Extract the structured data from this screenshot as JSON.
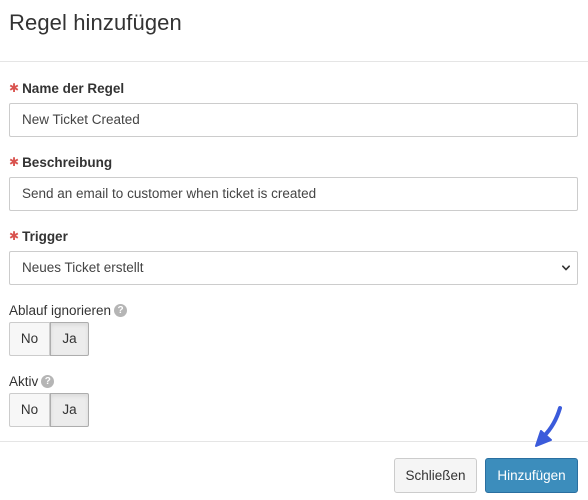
{
  "modal": {
    "title": "Regel hinzufügen"
  },
  "form": {
    "name": {
      "label": "Name der Regel",
      "required_mark": "✱",
      "value": "New Ticket Created"
    },
    "description": {
      "label": "Beschreibung",
      "required_mark": "✱",
      "value": "Send an email to customer when ticket is created"
    },
    "trigger": {
      "label": "Trigger",
      "required_mark": "✱",
      "selected": "Neues Ticket erstellt"
    },
    "ignore_flow": {
      "label": "Ablauf ignorieren",
      "help": "?",
      "no_label": "No",
      "yes_label": "Ja",
      "selected": "Ja"
    },
    "active": {
      "label": "Aktiv",
      "help": "?",
      "no_label": "No",
      "yes_label": "Ja",
      "selected": "Ja"
    }
  },
  "footer": {
    "close_label": "Schließen",
    "add_label": "Hinzufügen"
  },
  "colors": {
    "primary": "#3c8dbc",
    "required": "#d9534f",
    "annotation_arrow": "#3b5bdb"
  },
  "icons": {
    "select_chevron": "chevron-down-icon",
    "help": "question-circle-icon",
    "annotation": "arrow-pointer-icon"
  }
}
